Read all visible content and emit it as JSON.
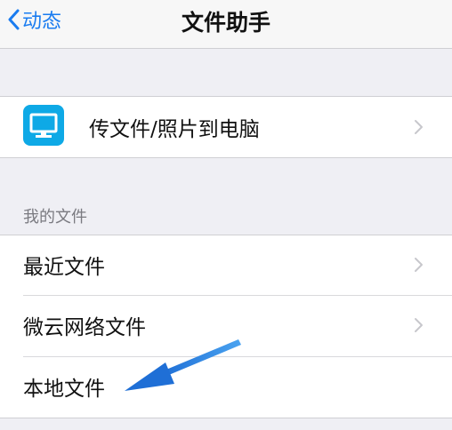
{
  "navbar": {
    "back_label": "动态",
    "title": "文件助手",
    "back_icon": "chevron-left-icon"
  },
  "transfer": {
    "label": "传文件/照片到电脑",
    "icon": "computer-monitor-icon",
    "icon_color": "#0ea9e6"
  },
  "my_files": {
    "header": "我的文件",
    "items": [
      {
        "label": "最近文件",
        "has_chevron": true
      },
      {
        "label": "微云网络文件",
        "has_chevron": true
      },
      {
        "label": "本地文件",
        "has_chevron": false
      }
    ]
  },
  "colors": {
    "accent": "#1a7cf0",
    "arrow_annotation": "#2a86e0"
  }
}
